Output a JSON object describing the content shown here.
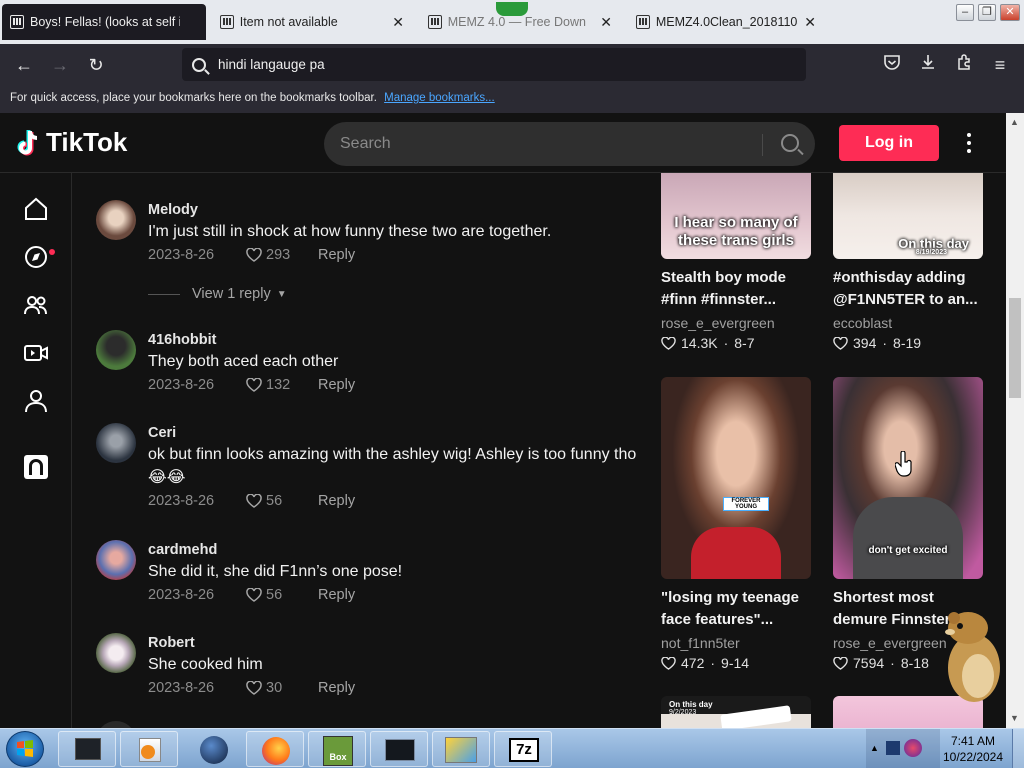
{
  "browser": {
    "tabs": [
      {
        "title": "Boys! Fellas! (looks at self in",
        "active": true
      },
      {
        "title": "Item not available",
        "active": false
      },
      {
        "title": "MEMZ 4.0 — Free Down",
        "active": false
      },
      {
        "title": "MEMZ4.0Clean_20181103 di",
        "active": false
      }
    ],
    "url": "hindi langauge pa",
    "bookmarks_hint": "For quick access, place your bookmarks here on the bookmarks toolbar.",
    "bookmarks_link": "Manage bookmarks..."
  },
  "tiktok": {
    "logo": "TikTok",
    "search_placeholder": "Search",
    "login_label": "Log in",
    "brand_color": "#fe2c55"
  },
  "comments": [
    {
      "user": "Melody",
      "text": "I'm just still in shock at how funny these two are together.",
      "date": "2023-8-26",
      "likes": "293",
      "reply": "Reply",
      "avatar_color": "#6b4a3e"
    },
    {
      "user": "416hobbit",
      "text": "They both aced each other",
      "date": "2023-8-26",
      "likes": "132",
      "reply": "Reply",
      "avatar_color": "#3a5a3a"
    },
    {
      "user": "Ceri",
      "text": "ok but finn looks amazing with the ashley wig! Ashley is too funny tho😂😂",
      "date": "2023-8-26",
      "likes": "56",
      "reply": "Reply",
      "avatar_color": "#4b5566"
    },
    {
      "user": "cardmehd",
      "text": "She did it, she did F1nn’s one pose!",
      "date": "2023-8-26",
      "likes": "56",
      "reply": "Reply",
      "avatar_color": "#5a6fb0"
    },
    {
      "user": "Robert",
      "text": "She cooked him",
      "date": "2023-8-26",
      "likes": "30",
      "reply": "Reply",
      "avatar_color": "#c8c8b8"
    }
  ],
  "view_reply": "View 1 reply",
  "videos": [
    {
      "title": "Stealth boy mode #finn #finnster...",
      "author": "rose_e_evergreen",
      "likes": "14.3K",
      "date": "8-7",
      "caption": "I hear so many of these trans girls"
    },
    {
      "title": "#onthisday adding @F1NN5TER to an...",
      "author": "eccoblast",
      "likes": "394",
      "date": "8-19",
      "caption": "On this day",
      "caption_small": "8/19/2023"
    },
    {
      "title": "\"losing my teenage face features\"...",
      "author": "not_f1nn5ter",
      "likes": "472",
      "date": "9-14",
      "caption": "FOREVER YOUNG"
    },
    {
      "title": "Shortest most demure Finnster",
      "author": "rose_e_evergreen",
      "likes": "7594",
      "date": "8-18",
      "caption": "don't get excited"
    },
    {
      "caption": "On this day",
      "caption_small": "9/2/2023"
    }
  ],
  "taskbar": {
    "time": "7:41 AM",
    "date": "10/22/2024",
    "seven_zip_label": "7z",
    "box_label": "Box"
  }
}
